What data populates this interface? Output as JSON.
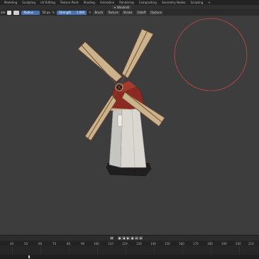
{
  "topbar": {
    "workspaces": [
      "Modeling",
      "Sculpting",
      "UV Editing",
      "Texture Paint",
      "Shading",
      "Animation",
      "Rendering",
      "Compositing",
      "Geometry Nodes",
      "Scripting"
    ],
    "add_label": "+"
  },
  "header": {
    "object_name": "Windmill"
  },
  "toolbar": {
    "mode_label": "ate",
    "radius_label": "Radius",
    "radius_unit": "50 px",
    "strength_label": "Strength",
    "strength_value": "1.000",
    "brush_label": "Brush",
    "texture_label": "Texture",
    "stroke_label": "Stroke",
    "falloff_label": "Falloff",
    "options_label": "Options"
  },
  "timeline": {
    "ticks": [
      "40",
      "50",
      "60",
      "70",
      "80",
      "90",
      "100",
      "110",
      "120",
      "130",
      "140",
      "150",
      "160",
      "170",
      "180",
      "190",
      "200",
      "210"
    ]
  },
  "colors": {
    "viewport_bg": "#3d3d3d",
    "brush_circle": "#c9484a",
    "accent_blue": "#4772b3",
    "roof_red": "#8b2a22",
    "blade_tan": "#c9b48e"
  }
}
